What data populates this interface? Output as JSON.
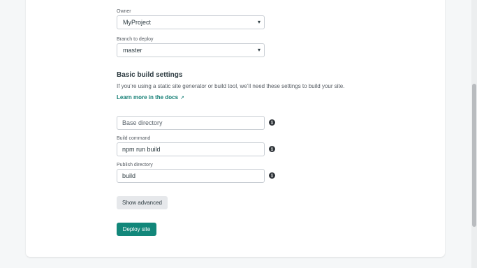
{
  "owner": {
    "label": "Owner",
    "value": "MyProject"
  },
  "branch": {
    "label": "Branch to deploy",
    "value": "master"
  },
  "build_settings": {
    "heading": "Basic build settings",
    "description": "If you’re using a static site generator or build tool, we’ll need these settings to build your site.",
    "learn_more": "Learn more in the docs",
    "learn_more_arrow": "↗"
  },
  "base_directory": {
    "placeholder": "Base directory"
  },
  "build_command": {
    "label": "Build command",
    "value": "npm run build"
  },
  "publish_directory": {
    "label": "Publish directory",
    "value": "build"
  },
  "buttons": {
    "show_advanced": "Show advanced",
    "deploy": "Deploy site"
  },
  "icons": {
    "info": "i",
    "chevron": "▾"
  },
  "colors": {
    "accent": "#12877a",
    "link": "#0f7c72"
  }
}
